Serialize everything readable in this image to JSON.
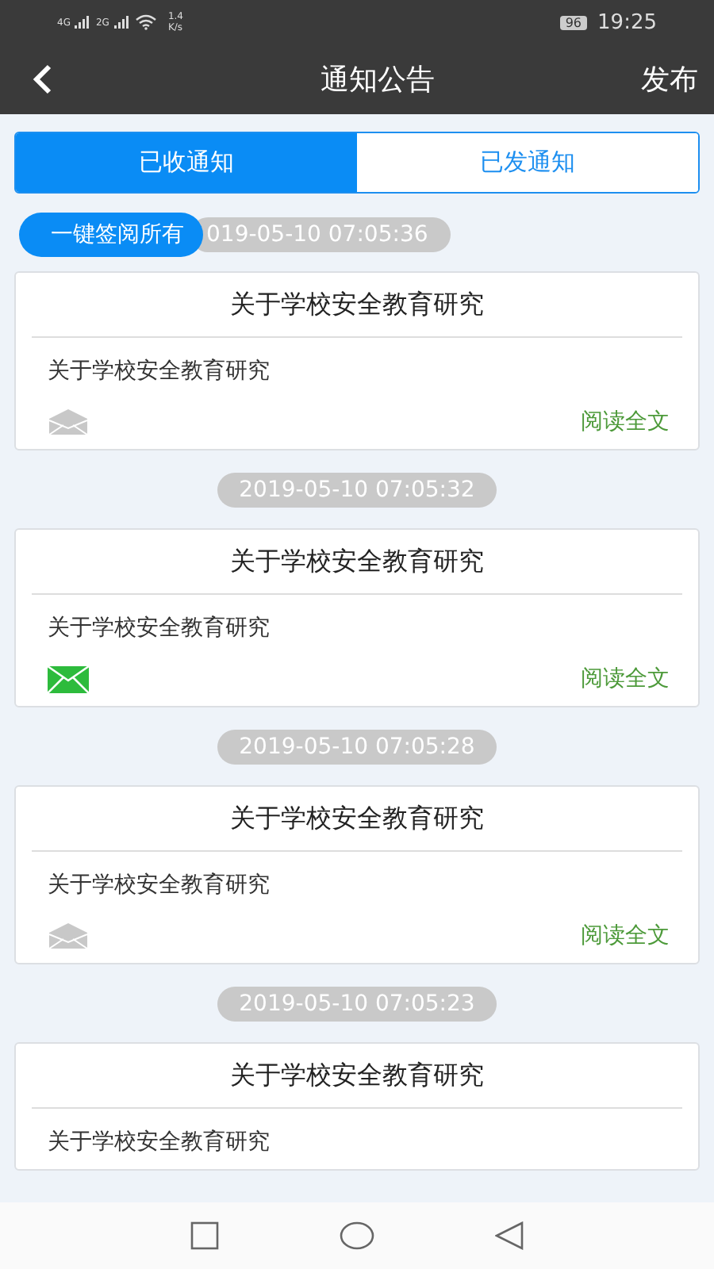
{
  "status_bar": {
    "net1": "4G",
    "net2": "2G",
    "speed": "1.4",
    "speed_unit": "K/s",
    "battery": "96",
    "time": "19:25"
  },
  "header": {
    "title": "通知公告",
    "action": "发布"
  },
  "tabs": [
    {
      "label": "已收通知",
      "selected": true
    },
    {
      "label": "已发通知",
      "selected": false
    }
  ],
  "sign_all_button": "一键签阅所有",
  "notices": [
    {
      "date": "019-05-10 07:05:36",
      "title": "关于学校安全教育研究",
      "summary": "关于学校安全教育研究",
      "read": true,
      "link": "阅读全文"
    },
    {
      "date": "2019-05-10 07:05:32",
      "title": "关于学校安全教育研究",
      "summary": "关于学校安全教育研究",
      "read": false,
      "link": "阅读全文"
    },
    {
      "date": "2019-05-10 07:05:28",
      "title": "关于学校安全教育研究",
      "summary": "关于学校安全教育研究",
      "read": true,
      "link": "阅读全文"
    },
    {
      "date": "2019-05-10 07:05:23",
      "title": "关于学校安全教育研究",
      "summary": "关于学校安全教育研究"
    }
  ]
}
